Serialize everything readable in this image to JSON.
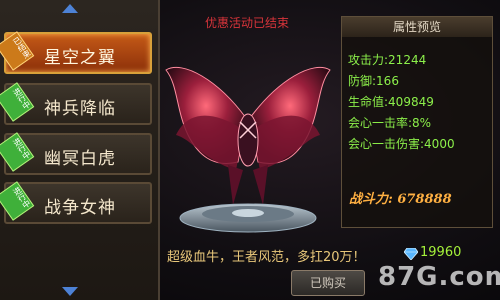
{
  "sidebar": {
    "items": [
      {
        "label": "星空之翼",
        "badge": "已结束",
        "active": true
      },
      {
        "label": "神兵降临",
        "badge": "进行中",
        "active": false
      },
      {
        "label": "幽冥白虎",
        "badge": "进行中",
        "active": false
      },
      {
        "label": "战争女神",
        "badge": "进行中",
        "active": false
      }
    ],
    "up_icon": "arrow-up-icon",
    "down_icon": "arrow-down-icon"
  },
  "main": {
    "promo_status": "优惠活动已结束",
    "description": "超级血牛，王者风范，多扛20万！",
    "price": "19960",
    "price_icon": "diamond-icon",
    "buy_label": "已购买"
  },
  "attributes": {
    "title": "属性预览",
    "rows": [
      {
        "name": "攻击力:",
        "value": "21244"
      },
      {
        "name": "防御:",
        "value": "166"
      },
      {
        "name": "生命值:",
        "value": "409849"
      },
      {
        "name": "会心一击率:",
        "value": "8%"
      },
      {
        "name": "会心一击伤害:",
        "value": "4000"
      }
    ],
    "power_label": "战斗力:",
    "power_value": "678888"
  },
  "watermark": "87G.com",
  "colors": {
    "accent": "#c55a17",
    "stat": "#8cf04a",
    "power": "#ffb042",
    "alert": "#d8343a"
  }
}
